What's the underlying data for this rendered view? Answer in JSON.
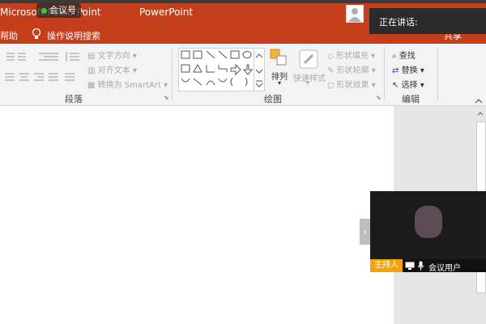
{
  "titlebar": {
    "meeting_badge": "会议号",
    "app_title": "Microsoft PowerPoint",
    "app_name": "PowerPoint",
    "speaking_label": "正在讲话:"
  },
  "tabs": {
    "help": "帮助",
    "tell_me": "操作说明搜索",
    "share": "共享"
  },
  "paragraph_group": {
    "label": "段落",
    "text_direction": "文字方向",
    "align_text": "对齐文本",
    "convert_smartart": "转换为 SmartArt"
  },
  "drawing_group": {
    "label": "绘图",
    "arrange": "排列",
    "quick_styles": "快速样式",
    "shape_fill": "形状填充",
    "shape_outline": "形状轮廓",
    "shape_effects": "形状效果"
  },
  "editing_group": {
    "label": "编辑",
    "find": "查找",
    "replace": "替换",
    "select": "选择"
  },
  "video": {
    "host_badge": "主持人",
    "user_name": "会议用户"
  },
  "colors": {
    "accent": "#c43e1c",
    "host_badge": "#f0a30a"
  }
}
